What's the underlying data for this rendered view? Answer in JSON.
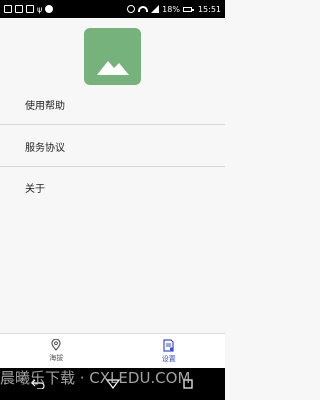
{
  "status_bar": {
    "battery": "18%",
    "time": "15:51",
    "icons": [
      "image-icon",
      "grid-icon",
      "mail-icon",
      "usb-icon",
      "android-icon",
      "no-sim-icon",
      "wifi-icon",
      "signal-icon",
      "battery-icon"
    ]
  },
  "logo": {
    "icon": "mountain-icon",
    "color": "#75b27c"
  },
  "menu": {
    "items": [
      {
        "label": "使用帮助"
      },
      {
        "label": "服务协议"
      },
      {
        "label": "关于"
      }
    ]
  },
  "tab_bar": {
    "tabs": [
      {
        "label": "海拔",
        "icon": "location-pin-icon",
        "active": false
      },
      {
        "label": "设置",
        "icon": "document-settings-icon",
        "active": true
      }
    ],
    "active_color": "#3a4fd6"
  },
  "watermark": {
    "text": "晨曦乐下载 · CXLEDU.COM"
  },
  "nav_bar": {
    "icons": [
      "back-icon",
      "home-icon",
      "recents-icon"
    ]
  }
}
